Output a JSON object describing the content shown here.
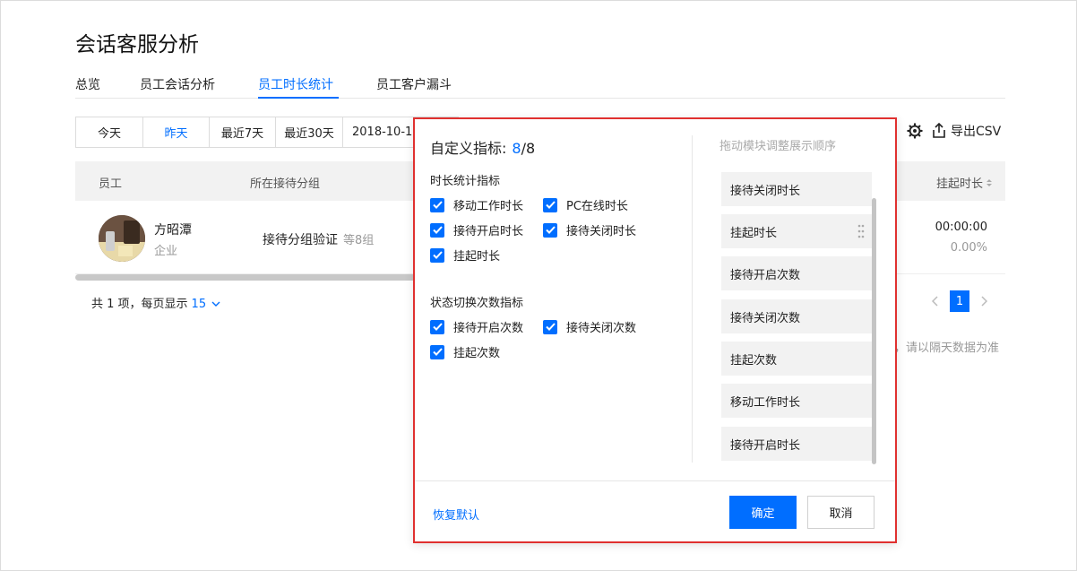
{
  "page": {
    "title": "会话客服分析"
  },
  "tabs": [
    {
      "label": "总览"
    },
    {
      "label": "员工会话分析"
    },
    {
      "label": "员工时长统计"
    },
    {
      "label": "员工客户漏斗"
    }
  ],
  "date_filter": {
    "options": [
      "今天",
      "昨天",
      "最近7天",
      "最近30天"
    ],
    "selected": "昨天",
    "date_value": "2018-10-1"
  },
  "toolbar": {
    "export_label": "导出CSV"
  },
  "table": {
    "columns": {
      "employee": "员工",
      "group": "所在接待分组",
      "suspend": "挂起时长"
    },
    "rows": [
      {
        "name": "方昭潭",
        "corp": "企业",
        "group": "接待分组验证",
        "group_more": "等8组",
        "suspend_time": "00:00:00",
        "suspend_pct": "0.00%"
      }
    ]
  },
  "pagination": {
    "total_text": "共 1 项，每页显示",
    "page_size": "15",
    "current_page": "1",
    "note": "，请以隔天数据为准"
  },
  "modal": {
    "title": "自定义指标:",
    "selected_count": "8",
    "total_count": "/8",
    "section1": {
      "title": "时长统计指标",
      "items": [
        "移动工作时长",
        "PC在线时长",
        "接待开启时长",
        "接待关闭时长",
        "挂起时长"
      ]
    },
    "section2": {
      "title": "状态切换次数指标",
      "items": [
        "接待开启次数",
        "接待关闭次数",
        "挂起次数"
      ]
    },
    "sort_hint": "拖动模块调整展示顺序",
    "sort_items": [
      "接待关闭时长",
      "挂起时长",
      "接待开启次数",
      "接待关闭次数",
      "挂起次数",
      "移动工作时长",
      "接待开启时长"
    ],
    "restore_label": "恢复默认",
    "ok_label": "确定",
    "cancel_label": "取消"
  },
  "colors": {
    "accent": "#006eff",
    "highlight_border": "#e0302f"
  }
}
